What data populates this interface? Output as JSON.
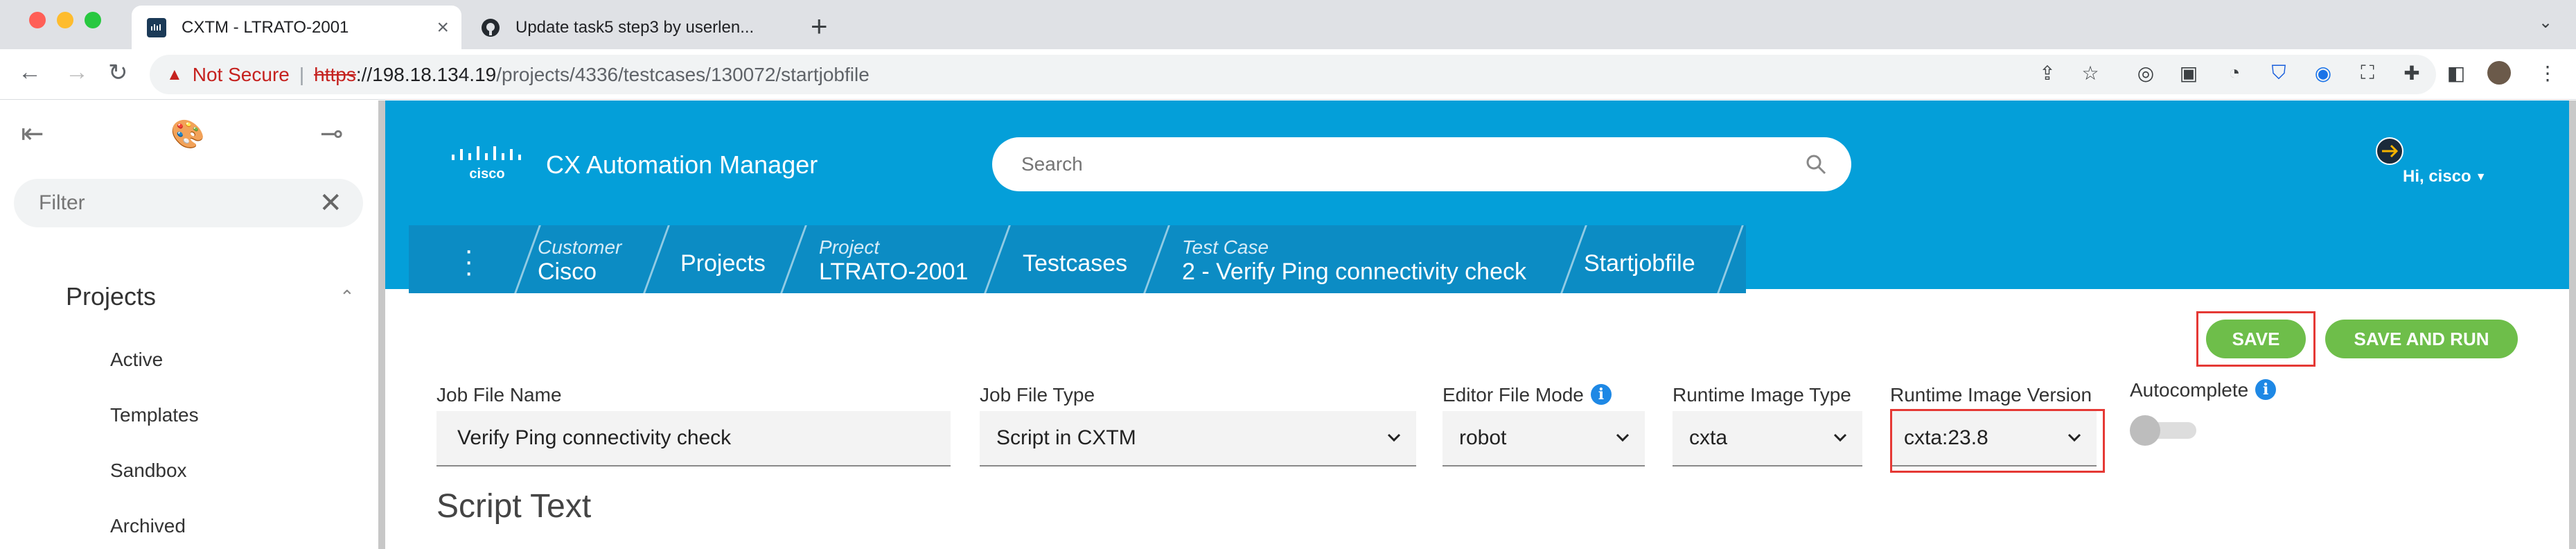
{
  "browser": {
    "tabs": [
      {
        "title": "CXTM - LTRATO-2001",
        "active": true
      },
      {
        "title": "Update task5 step3 by userlen...",
        "active": false
      }
    ],
    "address": {
      "not_secure": "Not Secure",
      "protocol": "https",
      "host": "://198.18.134.19",
      "path": "/projects/4336/testcases/130072/startjobfile"
    }
  },
  "sidebar": {
    "filter_placeholder": "Filter",
    "section_title": "Projects",
    "items": [
      {
        "label": "Active"
      },
      {
        "label": "Templates"
      },
      {
        "label": "Sandbox"
      },
      {
        "label": "Archived"
      }
    ]
  },
  "header": {
    "app_name": "CX Automation Manager",
    "search_placeholder": "Search",
    "user": "Hi, cisco"
  },
  "breadcrumb": {
    "customer_label": "Customer",
    "customer_value": "Cisco",
    "projects": "Projects",
    "project_label": "Project",
    "project_value": "LTRATO-2001",
    "testcases": "Testcases",
    "testcase_label": "Test Case",
    "testcase_value": "2 - Verify Ping connectivity check",
    "startjobfile": "Startjobfile"
  },
  "toolbar": {
    "save": "SAVE",
    "save_and_run": "SAVE AND RUN"
  },
  "form": {
    "job_file_name_label": "Job File Name",
    "job_file_name_value": "Verify Ping connectivity check",
    "job_file_type_label": "Job File Type",
    "job_file_type_value": "Script in CXTM",
    "editor_mode_label": "Editor File Mode",
    "editor_mode_value": "robot",
    "runtime_type_label": "Runtime Image Type",
    "runtime_type_value": "cxta",
    "runtime_version_label": "Runtime Image Version",
    "runtime_version_value": "cxta:23.8",
    "autocomplete_label": "Autocomplete",
    "info_glyph": "i"
  },
  "script": {
    "title": "Script Text"
  },
  "colors": {
    "header_blue": "#049fd9",
    "breadcrumb_blue": "#0c8cc4",
    "button_green": "#6ebe4a",
    "highlight_red": "#e53935"
  }
}
